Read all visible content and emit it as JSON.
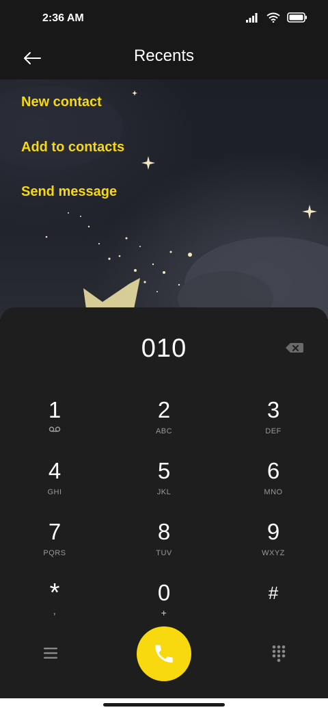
{
  "status": {
    "time": "2:36 AM"
  },
  "header": {
    "title": "Recents"
  },
  "actions": [
    {
      "label": "New contact"
    },
    {
      "label": "Add to contacts"
    },
    {
      "label": "Send message"
    }
  ],
  "dialer": {
    "number": "010",
    "keys": [
      {
        "digit": "1",
        "letters": ""
      },
      {
        "digit": "2",
        "letters": "ABC"
      },
      {
        "digit": "3",
        "letters": "DEF"
      },
      {
        "digit": "4",
        "letters": "GHI"
      },
      {
        "digit": "5",
        "letters": "JKL"
      },
      {
        "digit": "6",
        "letters": "MNO"
      },
      {
        "digit": "7",
        "letters": "PQRS"
      },
      {
        "digit": "8",
        "letters": "TUV"
      },
      {
        "digit": "9",
        "letters": "WXYZ"
      },
      {
        "digit": "*",
        "letters": ","
      },
      {
        "digit": "0",
        "letters": "+"
      },
      {
        "digit": "#",
        "letters": ""
      }
    ]
  },
  "colors": {
    "accent": "#f8d90f",
    "background": "#1e1e1e",
    "bar": "#181818"
  },
  "icons": [
    "signal-icon",
    "wifi-icon",
    "battery-icon",
    "back-arrow-icon",
    "backspace-icon",
    "voicemail-icon",
    "menu-icon",
    "phone-icon",
    "dialpad-icon"
  ]
}
